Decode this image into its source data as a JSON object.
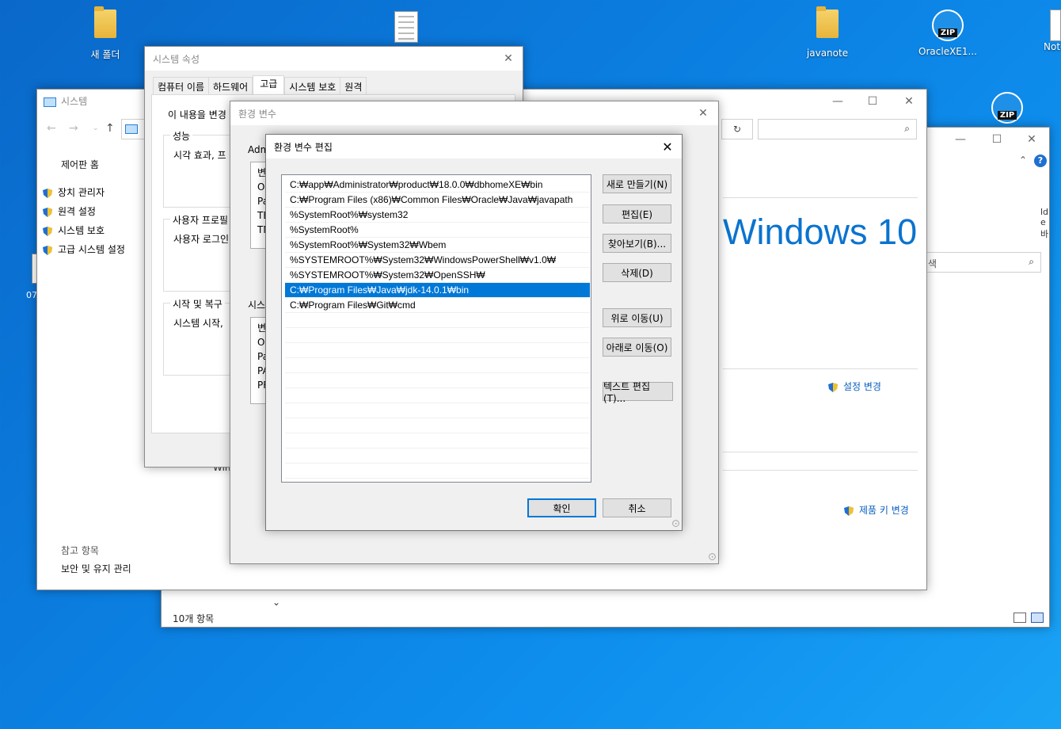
{
  "desktop": {
    "icons": [
      {
        "label": "새 폴더"
      },
      {
        "label": ""
      },
      {
        "label": "javanote"
      },
      {
        "label": "OracleXE1..."
      },
      {
        "label": "Note"
      }
    ],
    "side_text": "07",
    "zip_text": "ZIP"
  },
  "explorer": {
    "status": "10개 항목",
    "win10_logo": "Windows 10",
    "settings_change": "설정 변경",
    "product_key": "제품 키 변경",
    "search_hint": "색",
    "partial_left": "Win",
    "partial_right": "lde 바"
  },
  "system_window": {
    "title": "시스템",
    "nav_home": "제어판 홈",
    "links": [
      "장치 관리자",
      "원격 설정",
      "시스템 보호",
      "고급 시스템 설정"
    ],
    "see_also_title": "참고 항목",
    "see_also_link": "보안 및 유지 관리"
  },
  "system_props": {
    "title": "시스템 속성",
    "tabs": [
      "컴퓨터 이름",
      "하드웨어",
      "고급",
      "시스템 보호",
      "원격"
    ],
    "intro": "이 내용을 변경",
    "groups": [
      {
        "label": "성능",
        "text": "시각 효과, 프"
      },
      {
        "label": "사용자 프로필",
        "text": "사용자 로그인"
      },
      {
        "label": "시작 및 복구",
        "text": "시스템 시작,"
      }
    ]
  },
  "env_vars": {
    "title": "환경 변수",
    "user_group": "Adm",
    "user_rows": [
      "변",
      "On",
      "Pa",
      "TE",
      "TM"
    ],
    "sys_group": "시스",
    "sys_rows": [
      "변",
      "OS",
      "Pa",
      "PA",
      "PR"
    ]
  },
  "edit_dialog": {
    "title": "환경 변수 편집",
    "entries": [
      "C:₩app₩Administrator₩product₩18.0.0₩dbhomeXE₩bin",
      "C:₩Program Files (x86)₩Common Files₩Oracle₩Java₩javapath",
      "%SystemRoot%₩system32",
      "%SystemRoot%",
      "%SystemRoot%₩System32₩Wbem",
      "%SYSTEMROOT%₩System32₩WindowsPowerShell₩v1.0₩",
      "%SYSTEMROOT%₩System32₩OpenSSH₩",
      "C:₩Program Files₩Java₩jdk-14.0.1₩bin",
      "C:₩Program Files₩Git₩cmd"
    ],
    "selected_index": 7,
    "buttons": {
      "new": "새로 만들기(N)",
      "edit": "편집(E)",
      "browse": "찾아보기(B)...",
      "delete": "삭제(D)",
      "up": "위로 이동(U)",
      "down": "아래로 이동(O)",
      "text_edit": "텍스트 편집(T)...",
      "ok": "확인",
      "cancel": "취소"
    }
  }
}
